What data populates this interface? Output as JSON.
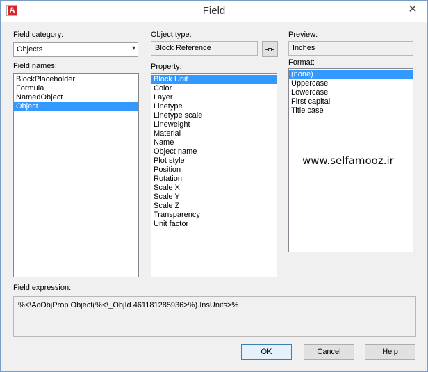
{
  "window": {
    "title": "Field",
    "app_icon_letter": "A",
    "close_glyph": "✕"
  },
  "field_category": {
    "label": "Field category:",
    "value": "Objects"
  },
  "field_names": {
    "label": "Field names:",
    "items": [
      "BlockPlaceholder",
      "Formula",
      "NamedObject",
      "Object"
    ],
    "selected_index": 3
  },
  "object_type": {
    "label": "Object type:",
    "value": "Block Reference"
  },
  "property": {
    "label": "Property:",
    "items": [
      "Block Unit",
      "Color",
      "Layer",
      "Linetype",
      "Linetype scale",
      "Lineweight",
      "Material",
      "Name",
      "Object name",
      "Plot style",
      "Position",
      "Rotation",
      "Scale X",
      "Scale Y",
      "Scale Z",
      "Transparency",
      "Unit factor"
    ],
    "selected_index": 0
  },
  "preview": {
    "label": "Preview:",
    "value": "Inches"
  },
  "format": {
    "label": "Format:",
    "items": [
      "(none)",
      "Uppercase",
      "Lowercase",
      "First capital",
      "Title case"
    ],
    "selected_index": 0
  },
  "watermark": "www.selfamooz.ir",
  "field_expression": {
    "label": "Field expression:",
    "value": "%<\\AcObjProp Object(%<\\_ObjId 461181285936>%).InsUnits>%"
  },
  "buttons": {
    "ok": "OK",
    "cancel": "Cancel",
    "help": "Help"
  },
  "icons": {
    "pick": "crosshair-icon",
    "dropdown": "chevron-down-icon"
  },
  "colors": {
    "selection": "#3399ff",
    "app_icon": "#d6252b"
  }
}
